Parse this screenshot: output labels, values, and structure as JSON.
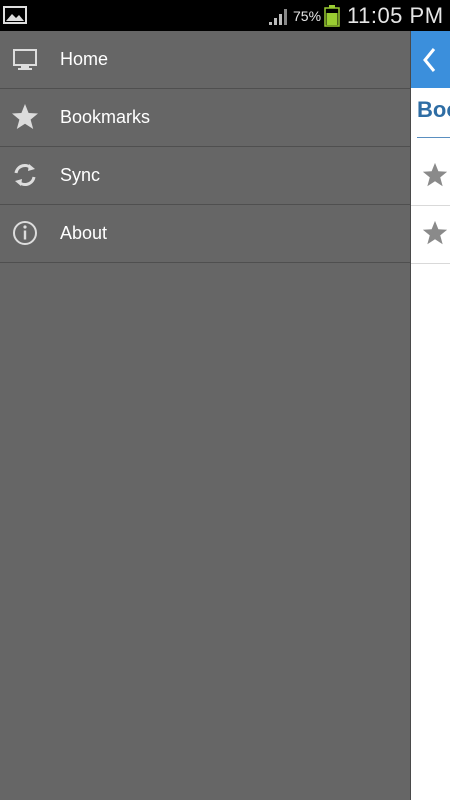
{
  "status_bar": {
    "battery_percent": "75%",
    "time": "11:05 PM",
    "icons": [
      "gallery-icon",
      "signal-icon",
      "battery-icon"
    ]
  },
  "drawer": {
    "items": [
      {
        "label": "Home",
        "icon": "monitor-icon"
      },
      {
        "label": "Bookmarks",
        "icon": "star-icon"
      },
      {
        "label": "Sync",
        "icon": "sync-icon"
      },
      {
        "label": "About",
        "icon": "info-icon"
      }
    ]
  },
  "content": {
    "title": "Boo",
    "accent_color": "#3b8fdc",
    "title_color": "#2e6da4"
  }
}
